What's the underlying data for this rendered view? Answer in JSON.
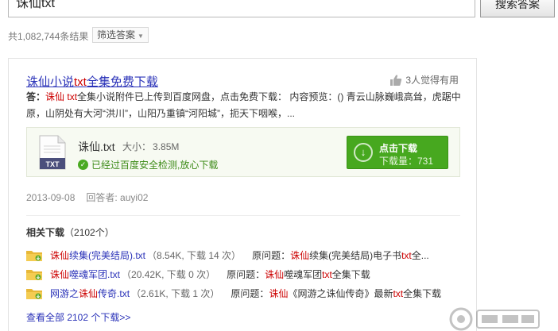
{
  "search": {
    "query": "诛仙txt",
    "button_label": "搜索答案"
  },
  "results": {
    "count_text": "共1,082,744条结果",
    "filter_label": "筛选答案"
  },
  "card": {
    "title": {
      "part1": "诛仙小说",
      "part2": "txt",
      "part3": "全集免费下载"
    },
    "helpful_text": "3人觉得有用",
    "answer": {
      "prefix": "答：",
      "hl1": "诛仙",
      "sp": " ",
      "hl2": "txt",
      "text": "全集小说附件已上传到百度网盘，点击免费下载： 内容预览：() 青云山脉巍峨高耸，虎踞中原，山阴处有大河“洪川”，山阳乃重镇“河阳城”，扼天下咽喉，..."
    },
    "file": {
      "name": "诛仙.txt",
      "size_label": "大小：",
      "size_value": "3.85M",
      "safe_text": "已经过百度安全检测,放心下载",
      "icon_label": "TXT",
      "download_label": "点击下载",
      "download_count": "下载量：731"
    },
    "date": "2013-09-08",
    "answerer": "回答者: auyi02"
  },
  "related": {
    "title": "相关下载",
    "count": "（2102个）",
    "items": [
      {
        "link_pre": "",
        "link_hl": "诛仙",
        "link_post": "续集(完美结局).txt",
        "info": "（8.54K, 下载 14 次）",
        "orig_label": "原问题：",
        "orig_hl": "诛仙",
        "orig_mid": "续集(完美结局)电子书",
        "orig_hl2": "txt",
        "orig_post": "全..."
      },
      {
        "link_pre": "",
        "link_hl": "诛仙",
        "link_post": "噬魂军团.txt",
        "info": "（20.42K, 下载 0 次）",
        "orig_label": "原问题：",
        "orig_hl": "诛仙",
        "orig_mid": "噬魂军团",
        "orig_hl2": "txt",
        "orig_post": "全集下载"
      },
      {
        "link_pre": "网游之",
        "link_hl": "诛仙",
        "link_post": "传奇.txt",
        "info": "（2.61K, 下载 1 次）",
        "orig_label": "原问题：",
        "orig_hl": "诛仙",
        "orig_mid": "《网游之诛仙传奇》最新",
        "orig_hl2": "txt",
        "orig_post": "全集下载"
      }
    ],
    "view_all": "查看全部 2102 个下载>>"
  },
  "colors": {
    "link": "#2a32b8",
    "highlight": "#cc0000",
    "download_green": "#47a81f",
    "safe_green": "#3d8b18"
  }
}
